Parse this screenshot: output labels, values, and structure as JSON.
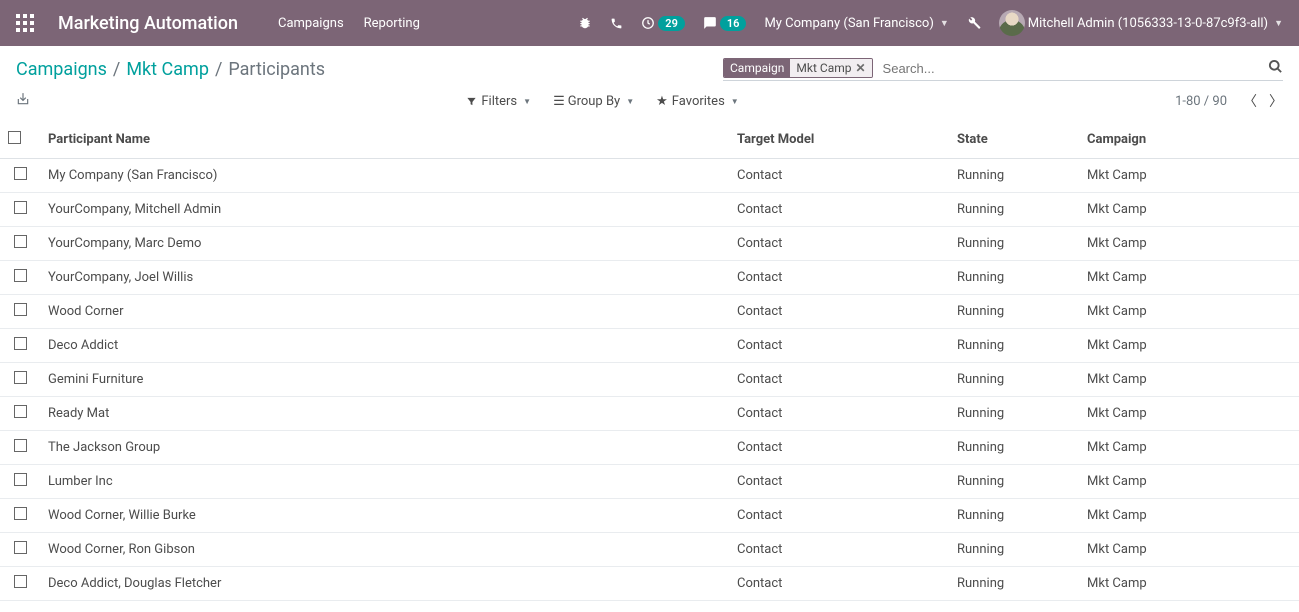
{
  "navbar": {
    "brand": "Marketing Automation",
    "menu": [
      "Campaigns",
      "Reporting"
    ],
    "activities_count": "29",
    "messages_count": "16",
    "company": "My Company (San Francisco)",
    "user": "Mitchell Admin (1056333-13-0-87c9f3-all)"
  },
  "breadcrumb": {
    "items": [
      {
        "label": "Campaigns",
        "link": true
      },
      {
        "label": "Mkt Camp",
        "link": true
      },
      {
        "label": "Participants",
        "link": false
      }
    ]
  },
  "search": {
    "facet_label": "Campaign",
    "facet_value": "Mkt Camp",
    "placeholder": "Search..."
  },
  "toolbar": {
    "filters": "Filters",
    "groupby": "Group By",
    "favorites": "Favorites",
    "pager": "1-80 / 90"
  },
  "table": {
    "headers": {
      "name": "Participant Name",
      "target": "Target Model",
      "state": "State",
      "campaign": "Campaign"
    },
    "rows": [
      {
        "name": "My Company (San Francisco)",
        "target": "Contact",
        "state": "Running",
        "campaign": "Mkt Camp"
      },
      {
        "name": "YourCompany, Mitchell Admin",
        "target": "Contact",
        "state": "Running",
        "campaign": "Mkt Camp"
      },
      {
        "name": "YourCompany, Marc Demo",
        "target": "Contact",
        "state": "Running",
        "campaign": "Mkt Camp"
      },
      {
        "name": "YourCompany, Joel Willis",
        "target": "Contact",
        "state": "Running",
        "campaign": "Mkt Camp"
      },
      {
        "name": "Wood Corner",
        "target": "Contact",
        "state": "Running",
        "campaign": "Mkt Camp"
      },
      {
        "name": "Deco Addict",
        "target": "Contact",
        "state": "Running",
        "campaign": "Mkt Camp"
      },
      {
        "name": "Gemini Furniture",
        "target": "Contact",
        "state": "Running",
        "campaign": "Mkt Camp"
      },
      {
        "name": "Ready Mat",
        "target": "Contact",
        "state": "Running",
        "campaign": "Mkt Camp"
      },
      {
        "name": "The Jackson Group",
        "target": "Contact",
        "state": "Running",
        "campaign": "Mkt Camp"
      },
      {
        "name": "Lumber Inc",
        "target": "Contact",
        "state": "Running",
        "campaign": "Mkt Camp"
      },
      {
        "name": "Wood Corner, Willie Burke",
        "target": "Contact",
        "state": "Running",
        "campaign": "Mkt Camp"
      },
      {
        "name": "Wood Corner, Ron Gibson",
        "target": "Contact",
        "state": "Running",
        "campaign": "Mkt Camp"
      },
      {
        "name": "Deco Addict, Douglas Fletcher",
        "target": "Contact",
        "state": "Running",
        "campaign": "Mkt Camp"
      }
    ]
  }
}
